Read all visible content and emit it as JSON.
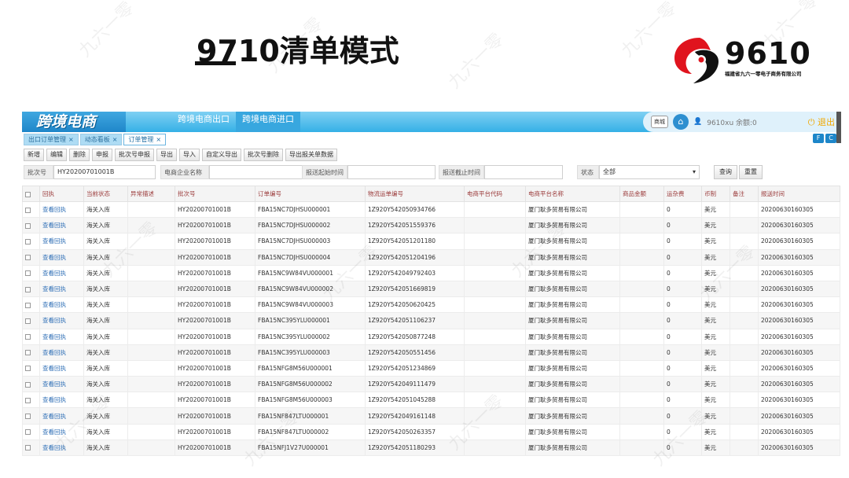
{
  "slide": {
    "title": "9710清单模式",
    "logo_text": "9610",
    "logo_subtitle": "福建省九六一零电子商务有限公司"
  },
  "app": {
    "brand": "跨境电商",
    "nav": [
      "跨境电商出口",
      "跨境电商进口"
    ],
    "top_right": {
      "mall_label": "商城",
      "user_text": "9610xu 余额:0",
      "logout_label": "退出"
    },
    "tabs": [
      {
        "label": "出口订单管理",
        "active": false
      },
      {
        "label": "动态看板",
        "active": false
      },
      {
        "label": "订单管理",
        "active": true
      }
    ],
    "corner_icons": [
      "F",
      "C"
    ],
    "toolbar": [
      "新增",
      "编辑",
      "删除",
      "申报",
      "批次号申报",
      "导出",
      "导入",
      "自定义导出",
      "批次号删除",
      "导出报关单数据"
    ],
    "filters": {
      "batch_label": "批次号",
      "batch_value": "HY20200701001B",
      "company_label": "电商企业名称",
      "company_value": "",
      "start_label": "报送起始时间",
      "start_value": "",
      "end_label": "报送截止时间",
      "end_value": "",
      "status_label": "状态",
      "status_value": "全部",
      "query_label": "查询",
      "reset_label": "重置"
    },
    "columns": [
      "回执",
      "当前状态",
      "异常描述",
      "批次号",
      "订单编号",
      "物流运单编号",
      "电商平台代码",
      "电商平台名称",
      "商品金额",
      "运杂费",
      "币制",
      "备注",
      "报送时间"
    ],
    "rows": [
      {
        "receipt": "查看回执",
        "status": "海关入库",
        "batch": "HY20200701001B",
        "order": "FBA15NC7DJHSU000001",
        "waybill": "1Z920Y542050934766",
        "platform": "厦门耿多贸易有限公司",
        "freight": "0",
        "currency": "美元",
        "time": "20200630160305"
      },
      {
        "receipt": "查看回执",
        "status": "海关入库",
        "batch": "HY20200701001B",
        "order": "FBA15NC7DJHSU000002",
        "waybill": "1Z920Y542051559376",
        "platform": "厦门耿多贸易有限公司",
        "freight": "0",
        "currency": "美元",
        "time": "20200630160305"
      },
      {
        "receipt": "查看回执",
        "status": "海关入库",
        "batch": "HY20200701001B",
        "order": "FBA15NC7DJHSU000003",
        "waybill": "1Z920Y542051201180",
        "platform": "厦门耿多贸易有限公司",
        "freight": "0",
        "currency": "美元",
        "time": "20200630160305"
      },
      {
        "receipt": "查看回执",
        "status": "海关入库",
        "batch": "HY20200701001B",
        "order": "FBA15NC7DJHSU000004",
        "waybill": "1Z920Y542051204196",
        "platform": "厦门耿多贸易有限公司",
        "freight": "0",
        "currency": "美元",
        "time": "20200630160305"
      },
      {
        "receipt": "查看回执",
        "status": "海关入库",
        "batch": "HY20200701001B",
        "order": "FBA15NC9W84VU000001",
        "waybill": "1Z920Y542049792403",
        "platform": "厦门耿多贸易有限公司",
        "freight": "0",
        "currency": "美元",
        "time": "20200630160305"
      },
      {
        "receipt": "查看回执",
        "status": "海关入库",
        "batch": "HY20200701001B",
        "order": "FBA15NC9W84VU000002",
        "waybill": "1Z920Y542051669819",
        "platform": "厦门耿多贸易有限公司",
        "freight": "0",
        "currency": "美元",
        "time": "20200630160305"
      },
      {
        "receipt": "查看回执",
        "status": "海关入库",
        "batch": "HY20200701001B",
        "order": "FBA15NC9W84VU000003",
        "waybill": "1Z920Y542050620425",
        "platform": "厦门耿多贸易有限公司",
        "freight": "0",
        "currency": "美元",
        "time": "20200630160305"
      },
      {
        "receipt": "查看回执",
        "status": "海关入库",
        "batch": "HY20200701001B",
        "order": "FBA15NC395YLU000001",
        "waybill": "1Z920Y542051106237",
        "platform": "厦门耿多贸易有限公司",
        "freight": "0",
        "currency": "美元",
        "time": "20200630160305"
      },
      {
        "receipt": "查看回执",
        "status": "海关入库",
        "batch": "HY20200701001B",
        "order": "FBA15NC395YLU000002",
        "waybill": "1Z920Y542050877248",
        "platform": "厦门耿多贸易有限公司",
        "freight": "0",
        "currency": "美元",
        "time": "20200630160305"
      },
      {
        "receipt": "查看回执",
        "status": "海关入库",
        "batch": "HY20200701001B",
        "order": "FBA15NC395YLU000003",
        "waybill": "1Z920Y542050551456",
        "platform": "厦门耿多贸易有限公司",
        "freight": "0",
        "currency": "美元",
        "time": "20200630160305"
      },
      {
        "receipt": "查看回执",
        "status": "海关入库",
        "batch": "HY20200701001B",
        "order": "FBA15NFG8M56U000001",
        "waybill": "1Z920Y542051234869",
        "platform": "厦门耿多贸易有限公司",
        "freight": "0",
        "currency": "美元",
        "time": "20200630160305"
      },
      {
        "receipt": "查看回执",
        "status": "海关入库",
        "batch": "HY20200701001B",
        "order": "FBA15NFG8M56U000002",
        "waybill": "1Z920Y542049111479",
        "platform": "厦门耿多贸易有限公司",
        "freight": "0",
        "currency": "美元",
        "time": "20200630160305"
      },
      {
        "receipt": "查看回执",
        "status": "海关入库",
        "batch": "HY20200701001B",
        "order": "FBA15NFG8M56U000003",
        "waybill": "1Z920Y542051045288",
        "platform": "厦门耿多贸易有限公司",
        "freight": "0",
        "currency": "美元",
        "time": "20200630160305"
      },
      {
        "receipt": "查看回执",
        "status": "海关入库",
        "batch": "HY20200701001B",
        "order": "FBA15NF847LTU000001",
        "waybill": "1Z920Y542049161148",
        "platform": "厦门耿多贸易有限公司",
        "freight": "0",
        "currency": "美元",
        "time": "20200630160305"
      },
      {
        "receipt": "查看回执",
        "status": "海关入库",
        "batch": "HY20200701001B",
        "order": "FBA15NF847LTU000002",
        "waybill": "1Z920Y542050263357",
        "platform": "厦门耿多贸易有限公司",
        "freight": "0",
        "currency": "美元",
        "time": "20200630160305"
      },
      {
        "receipt": "查看回执",
        "status": "海关入库",
        "batch": "HY20200701001B",
        "order": "FBA15NFJ1V27U000001",
        "waybill": "1Z920Y542051180293",
        "platform": "厦门耿多贸易有限公司",
        "freight": "0",
        "currency": "美元",
        "time": "20200630160305"
      }
    ]
  },
  "watermark_text": "九六一零",
  "colors": {
    "header_blue": "#35b0e6",
    "link_blue": "#2c6db5",
    "column_header_red": "#9b3b3b",
    "logo_red": "#e0141e"
  }
}
